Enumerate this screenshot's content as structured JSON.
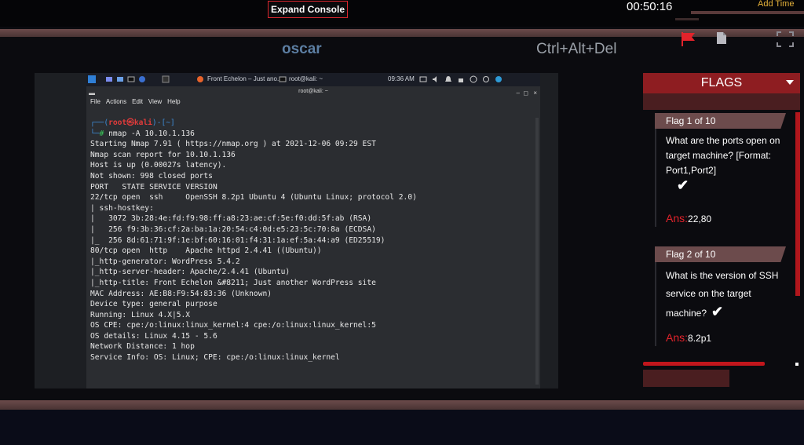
{
  "toolbar": {
    "expand_label": "Expand Console",
    "timer": "00:50:16",
    "add_time_label": "Add Time"
  },
  "session": {
    "name": "oscar",
    "ctrl_alt_del_label": "Ctrl+Alt+Del"
  },
  "vm": {
    "taskbar": {
      "firefox_label": "Front Echelon – Just ano...",
      "terminal_label": "root@kali: ~",
      "clock": "09:36 AM"
    },
    "terminal": {
      "title": "root@kali: ~",
      "menu": [
        "File",
        "Actions",
        "Edit",
        "View",
        "Help"
      ],
      "prompt_user": "root",
      "prompt_host": "kali",
      "prompt_dir": "~",
      "command": "nmap -A 10.10.1.136",
      "output": [
        "Starting Nmap 7.91 ( https://nmap.org ) at 2021-12-06 09:29 EST",
        "Nmap scan report for 10.10.1.136",
        "Host is up (0.00027s latency).",
        "Not shown: 998 closed ports",
        "PORT   STATE SERVICE VERSION",
        "22/tcp open  ssh     OpenSSH 8.2p1 Ubuntu 4 (Ubuntu Linux; protocol 2.0)",
        "| ssh-hostkey:",
        "|   3072 3b:28:4e:fd:f9:98:ff:a8:23:ae:cf:5e:f0:dd:5f:ab (RSA)",
        "|   256 f9:3b:36:cf:2a:ba:1a:20:54:c4:0d:e5:23:5c:70:8a (ECDSA)",
        "|_  256 8d:61:71:9f:1e:bf:60:16:01:f4:31:1a:ef:5a:44:a9 (ED25519)",
        "80/tcp open  http    Apache httpd 2.4.41 ((Ubuntu))",
        "|_http-generator: WordPress 5.4.2",
        "|_http-server-header: Apache/2.4.41 (Ubuntu)",
        "|_http-title: Front Echelon &#8211; Just another WordPress site",
        "MAC Address: AE:B8:F9:54:83:36 (Unknown)",
        "Device type: general purpose",
        "Running: Linux 4.X|5.X",
        "OS CPE: cpe:/o:linux:linux_kernel:4 cpe:/o:linux:linux_kernel:5",
        "OS details: Linux 4.15 - 5.6",
        "Network Distance: 1 hop",
        "Service Info: OS: Linux; CPE: cpe:/o:linux:linux_kernel"
      ]
    }
  },
  "flags": {
    "header": "FLAGS",
    "answer_label": "Ans:",
    "items": [
      {
        "title": "Flag 1 of 10",
        "question": "What are the ports open on target machine? [Format: Port1,Port2]",
        "answer": "22,80"
      },
      {
        "title": "Flag 2 of 10",
        "question": "What is the version of SSH service on the target machine?",
        "answer": "8.2p1"
      }
    ]
  },
  "colors": {
    "accent_red": "#e3232b",
    "panel_red": "#8e1d21",
    "session_blue": "#5c7ea2"
  }
}
